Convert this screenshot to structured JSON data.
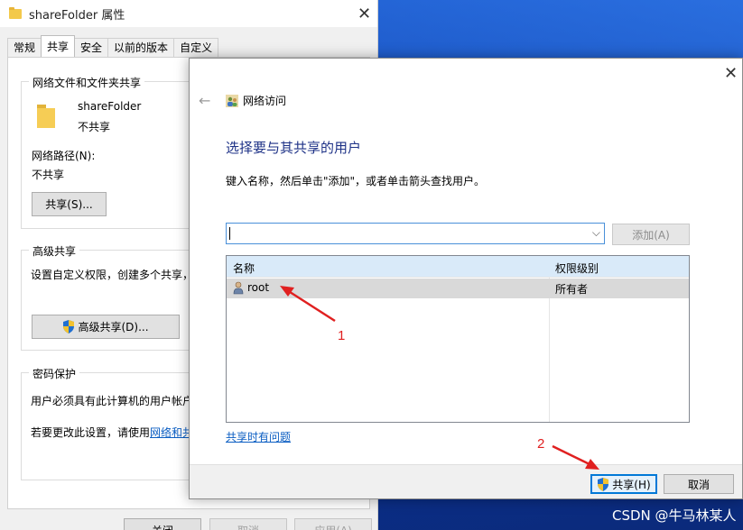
{
  "props_window": {
    "title": "shareFolder 属性",
    "close_glyph": "✕",
    "tabs": [
      {
        "label": "常规",
        "active": false
      },
      {
        "label": "共享",
        "active": true
      },
      {
        "label": "安全",
        "active": false
      },
      {
        "label": "以前的版本",
        "active": false
      },
      {
        "label": "自定义",
        "active": false
      }
    ],
    "network_sharing": {
      "legend": "网络文件和文件夹共享",
      "folder_name": "shareFolder",
      "folder_status": "不共享",
      "path_label": "网络路径(N):",
      "path_value": "不共享",
      "share_button": "共享(S)..."
    },
    "advanced_sharing": {
      "legend": "高级共享",
      "description": "设置自定义权限，创建多个共享，",
      "button": "高级共享(D)..."
    },
    "password_protection": {
      "legend": "密码保护",
      "line1": "用户必须具有此计算机的用户帐户",
      "line2_prefix": "若要更改此设置，请使用",
      "line2_link": "网络和共"
    },
    "bottom_buttons": {
      "close": "关闭",
      "cancel": "取消",
      "apply": "应用(A)"
    }
  },
  "dialog": {
    "close_glyph": "✕",
    "back_glyph": "←",
    "title": "网络访问",
    "heading": "选择要与其共享的用户",
    "instruction": "键入名称，然后单击\"添加\"，或者单击箭头查找用户。",
    "combo_value": "",
    "combo_arrow": "⌵",
    "add_button": "添加(A)",
    "list": {
      "columns": [
        "名称",
        "权限级别"
      ],
      "rows": [
        {
          "name": "root",
          "permission": "所有者"
        }
      ]
    },
    "trouble_link": "共享时有问题",
    "share_button": "共享(H)",
    "cancel_button": "取消"
  },
  "annotations": {
    "marker1": "1",
    "marker2": "2",
    "color": "#e02020"
  },
  "watermark": "CSDN @牛马林某人",
  "colors": {
    "accent": "#0078d7",
    "heading": "#1e3287",
    "link": "#0a5dc2",
    "list_header": "#d9eaf9",
    "selected_row": "#d9d9d9"
  }
}
